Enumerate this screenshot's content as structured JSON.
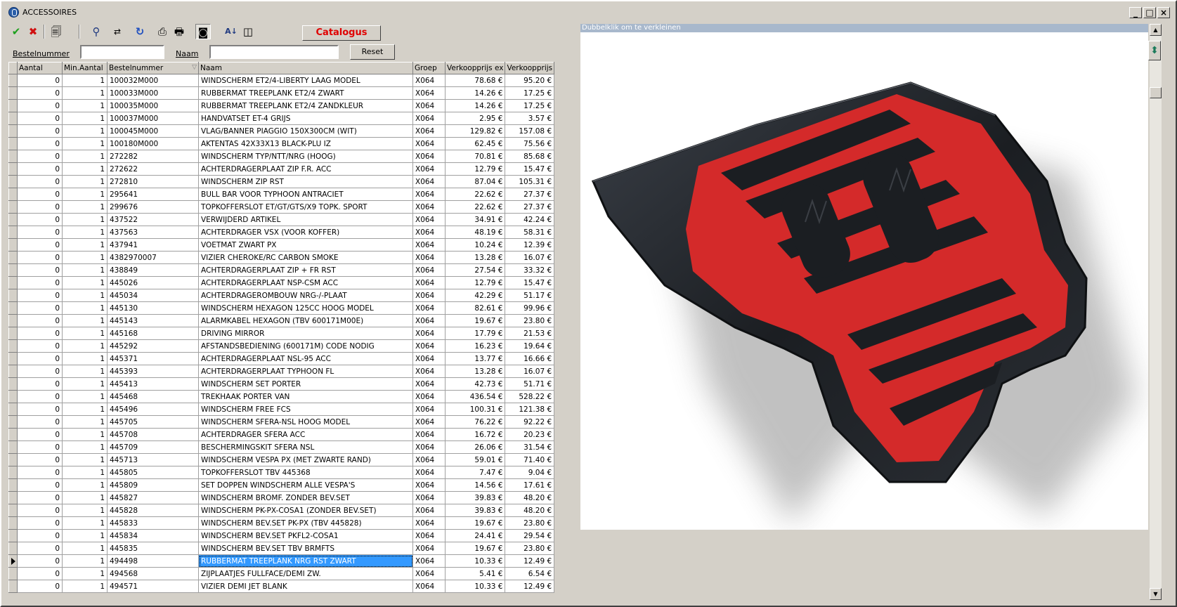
{
  "window": {
    "title": "ACCESSOIRES"
  },
  "toolbar": {
    "catalogus_label": "Catalogus",
    "icons": [
      "check-icon",
      "cancel-icon",
      "properties-icon",
      "binoculars-icon",
      "search-replace-icon",
      "refresh-icon",
      "print-icon",
      "print-preview-icon",
      "camera-icon",
      "sort-az-icon",
      "columns-icon"
    ]
  },
  "filters": {
    "bestelnummer_label": "Bestelnummer",
    "bestelnummer_value": "",
    "naam_label": "Naam",
    "naam_value": "",
    "reset_label": "Reset"
  },
  "grid": {
    "columns": [
      "Aantal",
      "Min.Aantal",
      "Bestelnummer",
      "Naam",
      "Groep",
      "Verkoopprijs ex",
      "Verkoopprijs"
    ],
    "rows": [
      [
        "0",
        "1",
        "100032M000",
        "WINDSCHERM ET2/4-LIBERTY LAAG MODEL",
        "X064",
        "78.68 €",
        "95.20 €"
      ],
      [
        "0",
        "1",
        "100033M000",
        "RUBBERMAT TREEPLANK ET2/4 ZWART",
        "X064",
        "14.26 €",
        "17.25 €"
      ],
      [
        "0",
        "1",
        "100035M000",
        "RUBBERMAT TREEPLANK ET2/4 ZANDKLEUR",
        "X064",
        "14.26 €",
        "17.25 €"
      ],
      [
        "0",
        "1",
        "100037M000",
        "HANDVATSET ET-4 GRIJS",
        "X064",
        "2.95 €",
        "3.57 €"
      ],
      [
        "0",
        "1",
        "100045M000",
        "VLAG/BANNER PIAGGIO 150X300CM (WIT)",
        "X064",
        "129.82 €",
        "157.08 €"
      ],
      [
        "0",
        "1",
        "100180M000",
        "AKTENTAS 42X33X13 BLACK-PLU IZ",
        "X064",
        "62.45 €",
        "75.56 €"
      ],
      [
        "0",
        "1",
        "272282",
        "WINDSCHERM TYP/NTT/NRG (HOOG)",
        "X064",
        "70.81 €",
        "85.68 €"
      ],
      [
        "0",
        "1",
        "272622",
        "ACHTERDRAGERPLAAT ZIP F.R. ACC",
        "X064",
        "12.79 €",
        "15.47 €"
      ],
      [
        "0",
        "1",
        "272810",
        "WINDSCHERM ZIP RST",
        "X064",
        "87.04 €",
        "105.31 €"
      ],
      [
        "0",
        "1",
        "295641",
        "BULL BAR VOOR TYPHOON ANTRACIET",
        "X064",
        "22.62 €",
        "27.37 €"
      ],
      [
        "0",
        "1",
        "299676",
        "TOPKOFFERSLOT  ET/GT/GTS/X9 TOPK. SPORT",
        "X064",
        "22.62 €",
        "27.37 €"
      ],
      [
        "0",
        "1",
        "437522",
        "VERWIJDERD ARTIKEL",
        "X064",
        "34.91 €",
        "42.24 €"
      ],
      [
        "0",
        "1",
        "437563",
        "ACHTERDRAGER VSX (VOOR KOFFER)",
        "X064",
        "48.19 €",
        "58.31 €"
      ],
      [
        "0",
        "1",
        "437941",
        "VOETMAT ZWART PX",
        "X064",
        "10.24 €",
        "12.39 €"
      ],
      [
        "0",
        "1",
        "4382970007",
        "VIZIER CHEROKE/RC CARBON SMOKE",
        "X064",
        "13.28 €",
        "16.07 €"
      ],
      [
        "0",
        "1",
        "438849",
        "ACHTERDRAGERPLAAT ZIP + FR RST",
        "X064",
        "27.54 €",
        "33.32 €"
      ],
      [
        "0",
        "1",
        "445026",
        "ACHTERDRAGERPLAAT NSP-CSM  ACC",
        "X064",
        "12.79 €",
        "15.47 €"
      ],
      [
        "0",
        "1",
        "445034",
        "ACHTERDRAGEROMBOUW NRG-/-PLAAT",
        "X064",
        "42.29 €",
        "51.17 €"
      ],
      [
        "0",
        "1",
        "445130",
        "WINDSCHERM HEXAGON 125CC HOOG MODEL",
        "X064",
        "82.61 €",
        "99.96 €"
      ],
      [
        "0",
        "1",
        "445143",
        "ALARMKABEL HEXAGON     (TBV 600171M00E)",
        "X064",
        "19.67 €",
        "23.80 €"
      ],
      [
        "0",
        "1",
        "445168",
        "DRIVING MIRROR",
        "X064",
        "17.79 €",
        "21.53 €"
      ],
      [
        "0",
        "1",
        "445292",
        "AFSTANDSBEDIENING (600171M) CODE NODIG",
        "X064",
        "16.23 €",
        "19.64 €"
      ],
      [
        "0",
        "1",
        "445371",
        "ACHTERDRAGERPLAAT NSL-95   ACC",
        "X064",
        "13.77 €",
        "16.66 €"
      ],
      [
        "0",
        "1",
        "445393",
        "ACHTERDRAGERPLAAT TYPHOON FL",
        "X064",
        "13.28 €",
        "16.07 €"
      ],
      [
        "0",
        "1",
        "445413",
        "WINDSCHERM SET PORTER",
        "X064",
        "42.73 €",
        "51.71 €"
      ],
      [
        "0",
        "1",
        "445468",
        "TREKHAAK PORTER VAN",
        "X064",
        "436.54 €",
        "528.22 €"
      ],
      [
        "0",
        "1",
        "445496",
        "WINDSCHERM FREE          FCS",
        "X064",
        "100.31 €",
        "121.38 €"
      ],
      [
        "0",
        "1",
        "445705",
        "WINDSCHERM SFERA-NSL HOOG MODEL",
        "X064",
        "76.22 €",
        "92.22 €"
      ],
      [
        "0",
        "1",
        "445708",
        "ACHTERDRAGER SFERA        ACC",
        "X064",
        "16.72 €",
        "20.23 €"
      ],
      [
        "0",
        "1",
        "445709",
        "BESCHERMINGSKIT SFERA      NSL",
        "X064",
        "26.06 €",
        "31.54 €"
      ],
      [
        "0",
        "1",
        "445713",
        "WINDSCHERM VESPA PX (MET ZWARTE RAND)",
        "X064",
        "59.01 €",
        "71.40 €"
      ],
      [
        "0",
        "1",
        "445805",
        "TOPKOFFERSLOT TBV 445368",
        "X064",
        "7.47 €",
        "9.04 €"
      ],
      [
        "0",
        "1",
        "445809",
        "SET DOPPEN WINDSCHERM ALLE VESPA'S",
        "X064",
        "14.56 €",
        "17.61 €"
      ],
      [
        "0",
        "1",
        "445827",
        "WINDSCHERM BROMF. ZONDER BEV.SET",
        "X064",
        "39.83 €",
        "48.20 €"
      ],
      [
        "0",
        "1",
        "445828",
        "WINDSCHERM PK-PX-COSA1 (ZONDER BEV.SET)",
        "X064",
        "39.83 €",
        "48.20 €"
      ],
      [
        "0",
        "1",
        "445833",
        "WINDSCHERM BEV.SET PK-PX (TBV 445828)",
        "X064",
        "19.67 €",
        "23.80 €"
      ],
      [
        "0",
        "1",
        "445834",
        "WINDSCHERM BEV.SET PKFL2-COSA1",
        "X064",
        "24.41 €",
        "29.54 €"
      ],
      [
        "0",
        "1",
        "445835",
        "WINDSCHERM BEV.SET TBV BRMFTS",
        "X064",
        "19.67 €",
        "23.80 €"
      ],
      [
        "0",
        "1",
        "494498",
        "RUBBERMAT TREEPLANK NRG RST ZWART",
        "X064",
        "10.33 €",
        "12.49 €"
      ],
      [
        "0",
        "1",
        "494568",
        "ZIJPLAATJES FULLFACE/DEMI ZW.",
        "X064",
        "5.41 €",
        "6.54 €"
      ],
      [
        "0",
        "1",
        "494571",
        "VIZIER DEMI JET BLANK",
        "X064",
        "10.33 €",
        "12.49 €"
      ]
    ],
    "current_row_index": 38
  },
  "image_panel": {
    "hint": "Dubbelklik om te verkleinen",
    "image_subject": "black rubber floor mat with red pattern (NRG)"
  },
  "colors": {
    "selection": "#3399ff",
    "catalogus_text": "#e00000",
    "mat_red": "#d42a2a",
    "mat_black": "#1b1e22"
  }
}
